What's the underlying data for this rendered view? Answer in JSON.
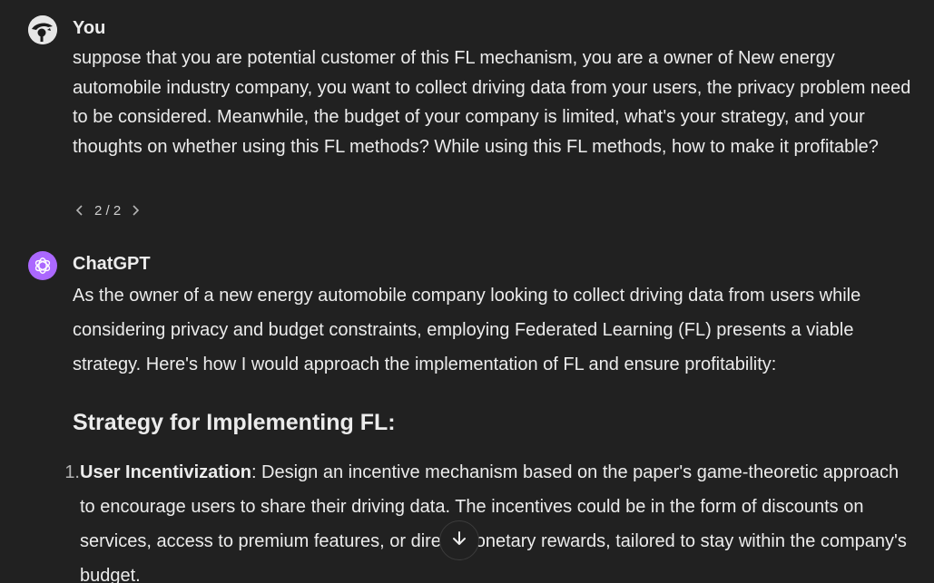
{
  "user": {
    "author": "You",
    "message": "suppose that you are potential customer of this FL mechanism, you are a owner of  New energy automobile industry company, you want to collect driving data from your users, the privacy problem need to be considered. Meanwhile, the budget of your company is limited, what's your strategy, and your thoughts on whether using this FL methods? While using this FL methods, how to make it profitable?",
    "pager": "2 / 2",
    "avatar_icon": "user-avatar-icon"
  },
  "assistant": {
    "author": "ChatGPT",
    "intro": "As the owner of a new energy automobile company looking to collect driving data from users while considering privacy and budget constraints, employing Federated Learning (FL) presents a viable strategy. Here's how I would approach the implementation of FL and ensure profitability:",
    "heading": "Strategy for Implementing FL:",
    "avatar_icon": "openai-logo-icon",
    "avatar_color": "#ab68ff",
    "list": [
      {
        "number": "1.",
        "title": "User Incentivization",
        "text": ": Design an incentive mechanism based on the paper's game-theoretic approach to encourage users to share their driving data. The incentives could be in the form of discounts on services, access to premium features, or direct monetary rewards, tailored to stay within the company's budget."
      }
    ]
  },
  "controls": {
    "scroll_down_icon": "arrow-down-icon"
  }
}
